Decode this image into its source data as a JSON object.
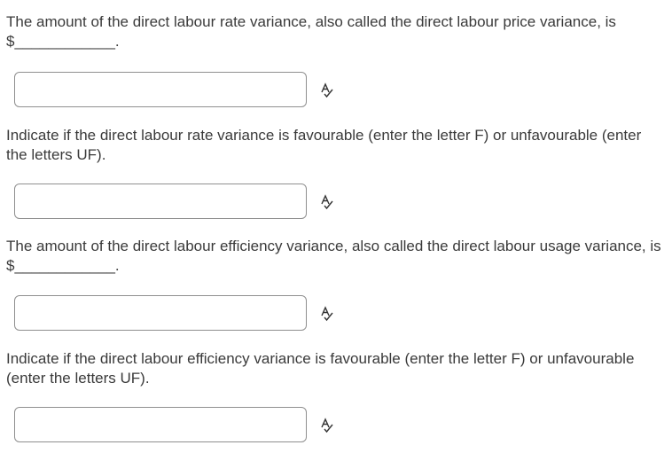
{
  "questions": [
    {
      "text": "The amount of the direct labour rate variance, also called the direct labour price variance, is $____________.",
      "value": "",
      "icon": "spellcheck-icon"
    },
    {
      "text": "Indicate if the direct labour rate variance is favourable (enter the letter F) or unfavourable (enter the letters UF).",
      "value": "",
      "icon": "spellcheck-icon"
    },
    {
      "text": "The amount of the direct labour efficiency variance, also called the direct labour usage variance, is $____________.",
      "value": "",
      "icon": "spellcheck-icon"
    },
    {
      "text": "Indicate if the direct labour efficiency variance is favourable (enter the letter F) or unfavourable (enter the letters UF).",
      "value": "",
      "icon": "spellcheck-icon"
    }
  ],
  "colors": {
    "text": "#3a3a3a",
    "input_border": "#8f8f8f",
    "icon": "#333333"
  }
}
